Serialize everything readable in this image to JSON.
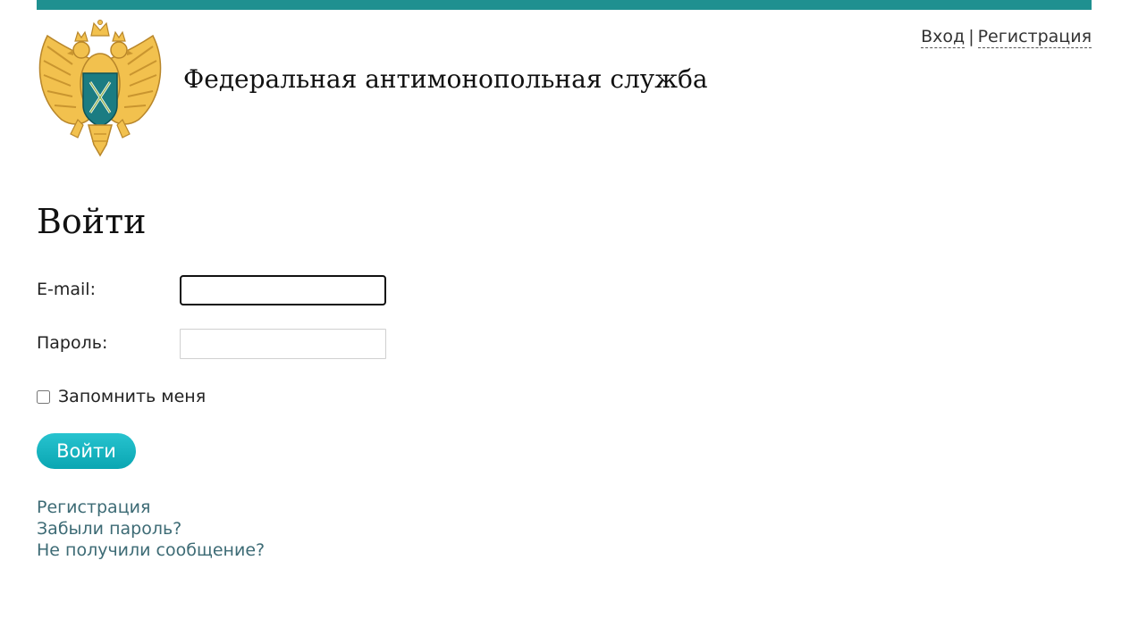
{
  "header": {
    "agency_name": "Федеральная антимонопольная служба",
    "login_link": "Вход",
    "separator": "|",
    "register_link": "Регистрация"
  },
  "login_form": {
    "title": "Войти",
    "email_label": "E-mail:",
    "email_value": "",
    "password_label": "Пароль:",
    "password_value": "",
    "remember_label": "Запомнить меня",
    "remember_checked": false,
    "submit_label": "Войти"
  },
  "footer_links": {
    "register": "Регистрация",
    "forgot_password": "Забыли пароль?",
    "no_message": "Не получили сообщение?"
  },
  "colors": {
    "top_bar": "#1f9090",
    "button": "#12b2be",
    "link": "#3d6b75",
    "emblem_gold": "#f2c14e",
    "emblem_shield": "#1b7c82"
  }
}
